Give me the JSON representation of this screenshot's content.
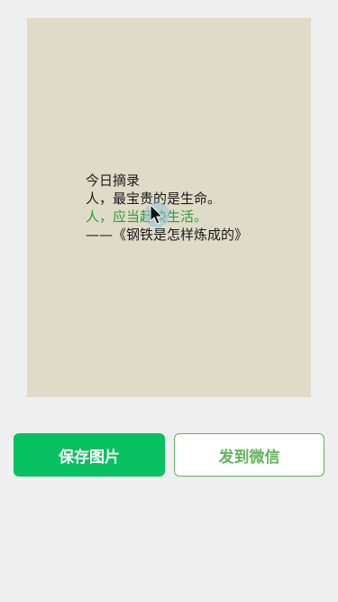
{
  "card": {
    "title": "今日摘录",
    "lines": [
      "人，最宝贵的是生命。",
      "人，应当赶快生活。",
      "——《钢铁是怎样炼成的》"
    ],
    "background": "#e0dbc8",
    "highlight_color": "#2a9d3f"
  },
  "actions": {
    "save_label": "保存图片",
    "send_label": "发到微信",
    "primary_color": "#07c160"
  },
  "cursor": {
    "icon": "mouse-pointer-icon"
  }
}
